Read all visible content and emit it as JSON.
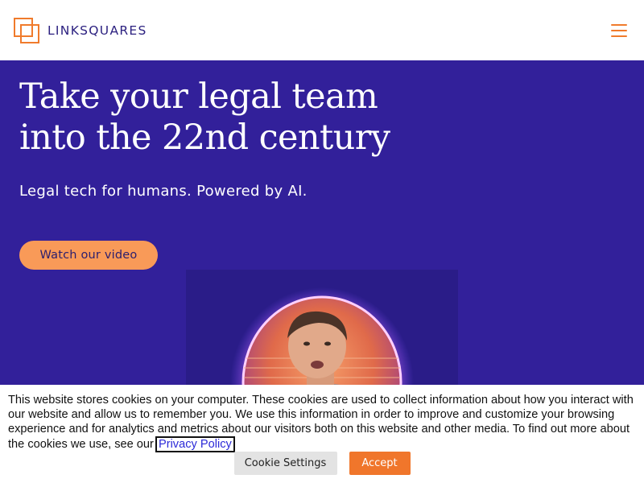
{
  "header": {
    "logo_text": "LINKSQUARES",
    "logo_icon": "linksquares-logo-icon",
    "menu_icon": "hamburger-menu-icon"
  },
  "hero": {
    "title_line1": "Take your legal team",
    "title_line2": "into the 22nd century",
    "subtitle": "Legal tech for humans. Powered by AI.",
    "video_button_label": "Watch our video",
    "video_image": "video-thumbnail-man-in-glowing-portal"
  },
  "cookie_banner": {
    "text": "This website stores cookies on your computer. These cookies are used to collect information about how you interact with our website and allow us to remember you. We use this information in order to improve and customize your browsing experience and for analytics and metrics about our visitors both on this website and other media. To find out more about the cookies we use, see our ",
    "privacy_link": "Privacy Policy",
    "settings_label": "Cookie Settings",
    "accept_label": "Accept"
  },
  "colors": {
    "brand_purple": "#32209a",
    "brand_orange": "#f07b2c",
    "button_orange": "#f99a58",
    "logo_text": "#2c2180"
  }
}
